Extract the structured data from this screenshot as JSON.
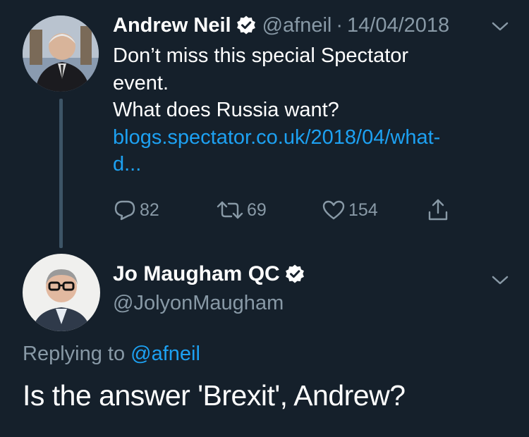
{
  "tweet1": {
    "author_name": "Andrew Neil",
    "handle": "@afneil",
    "separator": "·",
    "date": "14/04/2018",
    "body_lines": [
      "Don’t miss this special Spectator",
      "event.",
      "What does Russia want?"
    ],
    "link_lines": [
      "blogs.spectator.co.uk/2018/04/what-",
      "d..."
    ],
    "actions": {
      "replies": "82",
      "retweets": "69",
      "likes": "154"
    },
    "icons": [
      "verified-badge-icon",
      "chevron-down-icon",
      "reply-icon",
      "retweet-icon",
      "like-icon",
      "share-icon"
    ]
  },
  "tweet2": {
    "author_name": "Jo Maugham QC",
    "handle": "@JolyonMaugham",
    "replying_prefix": "Replying to",
    "replying_to": "@afneil",
    "body": "Is the answer 'Brexit', Andrew?"
  },
  "colors": {
    "background": "#15202b",
    "secondary_text": "#8899a6",
    "link": "#1da1f2",
    "thread_line": "#3d5466"
  }
}
